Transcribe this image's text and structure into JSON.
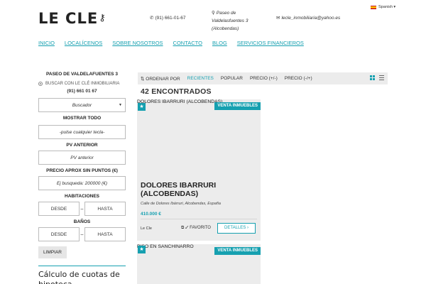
{
  "header": {
    "logo": "LE CLE",
    "language": "Spanish",
    "phone": "(91) 661-01-67",
    "address_line1": "Paseo de",
    "address_line2": "Valdelasfuentes 3",
    "address_line3": "(Alcobendas)",
    "email": "lecle_inmobiliaria@yahoo.es"
  },
  "nav": {
    "items": [
      "INICIO",
      "LOCALÍCENOS",
      "SOBRE NOSOTROS",
      "CONTACTO",
      "BLOG",
      "SERVICIOS FINANCIEROS"
    ]
  },
  "sidebar": {
    "title": "PASEO DE VALDELAFUENTES 3",
    "radio_label": "BUSCAR CON LE CLÉ INMOBILIARIA",
    "phone": "(91) 661 01 67",
    "select_value": "Buscador",
    "mostrar_label": "MOSTRAR TODO",
    "mostrar_placeholder": "-pulse cualquier tecla-",
    "pv_label": "PV ANTERIOR",
    "pv_placeholder": "PV anterior",
    "precio_label": "PRECIO APROX SIN PUNTOS (€)",
    "precio_placeholder": "Ej busqueda: 200000 (€)",
    "habitaciones_label": "HABITACIONES",
    "banos_label": "BAÑOS",
    "desde": "DESDE",
    "hasta": "HASTA",
    "dash": "–",
    "clear_button": "LIMPIAR",
    "calc_title": "Cálculo de cuotas de hipoteca"
  },
  "toolbar": {
    "ordenar": "ORDENAR POR",
    "options": [
      "RECIENTES",
      "POPULAR",
      "PRECIO (+/-)",
      "PRECIO (-/+)"
    ]
  },
  "results": {
    "count_text": "42 ENCONTRADOS"
  },
  "listings": [
    {
      "head": "DOLORES IBARRURI (ALCOBENDAS)",
      "badge": "VENTA INMUEBLES",
      "title": "DOLORES IBARRURI (ALCOBENDAS)",
      "address": "Calle de Dolores Ibárruri, Alcobendas, España",
      "price": "410.000 €",
      "author": "Le Cle",
      "favorite": "✓ FAVORITO",
      "details": "DETALLES ›"
    },
    {
      "head": "PISO EN SANCHINARRO",
      "badge": "VENTA INMUEBLES"
    }
  ],
  "colors": {
    "accent": "#16a0b0",
    "panel": "#ececec"
  }
}
